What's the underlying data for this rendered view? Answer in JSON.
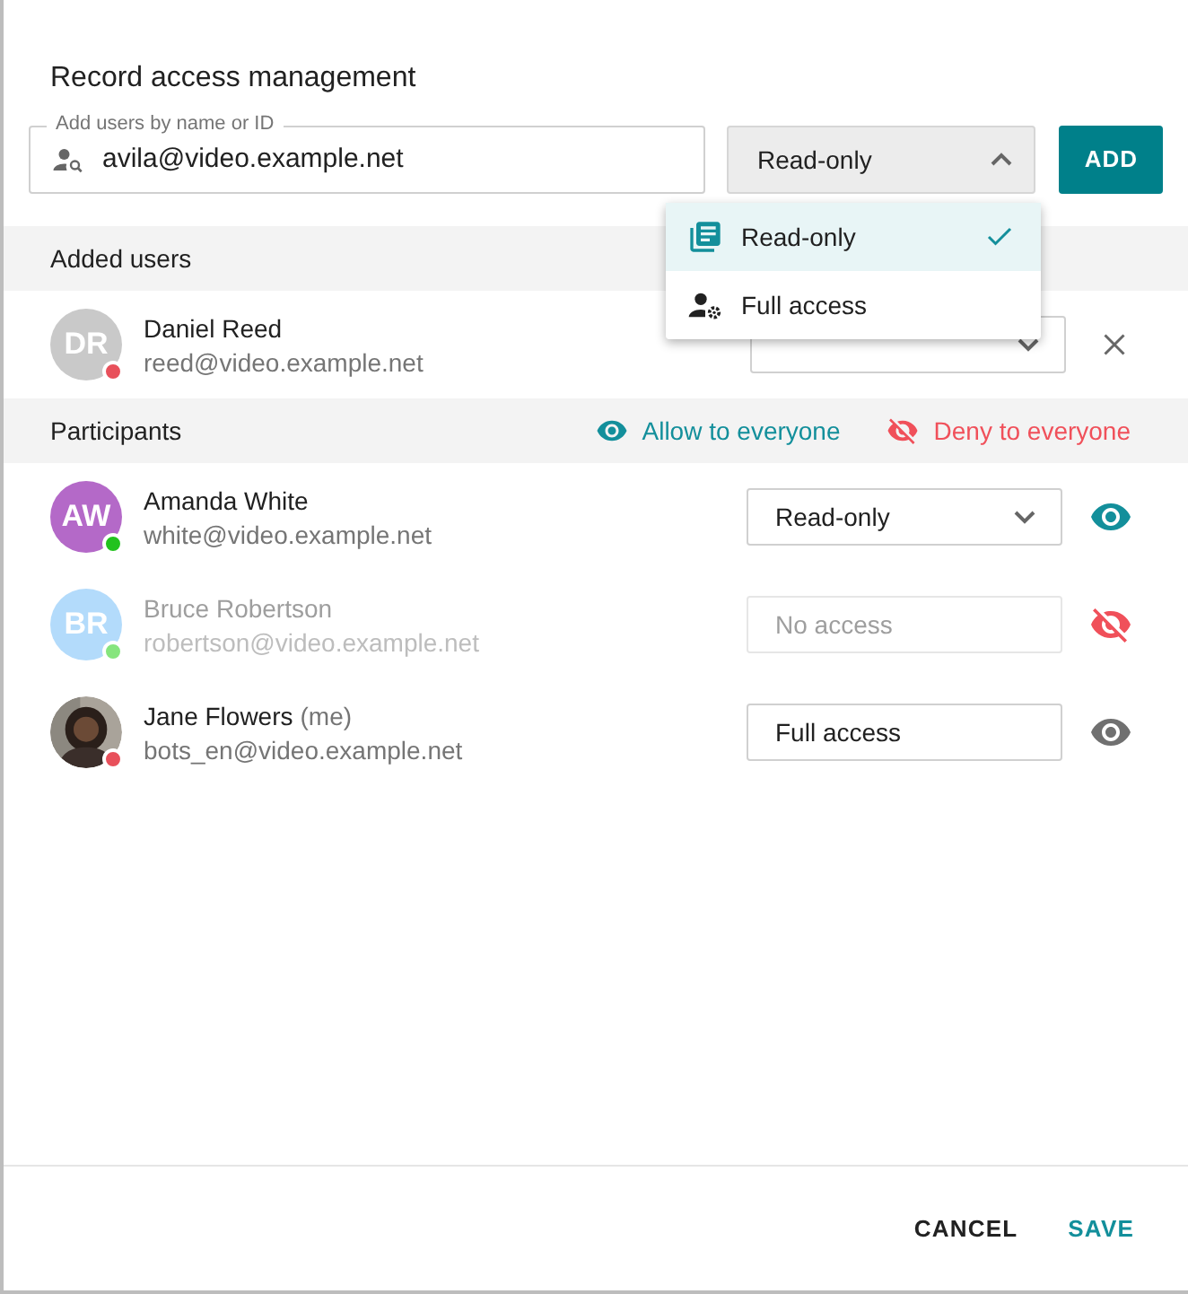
{
  "dialog": {
    "title": "Record access management"
  },
  "add_user": {
    "label": "Add users by name or ID",
    "value": "avila@video.example.net",
    "access": "Read-only",
    "expanded": true,
    "button": "ADD"
  },
  "access_menu": [
    {
      "label": "Read-only",
      "kind": "read",
      "selected": true
    },
    {
      "label": "Full access",
      "kind": "full",
      "selected": false
    }
  ],
  "added_users": {
    "title": "Added users",
    "rows": [
      {
        "avatar": {
          "initials": "DR",
          "color": "#c9c9c9"
        },
        "status": {
          "color": "#e8505b"
        },
        "name": "Daniel Reed",
        "email": "reed@video.example.net"
      }
    ]
  },
  "participants": {
    "title": "Participants",
    "allow_all": "Allow to everyone",
    "deny_all": "Deny to everyone",
    "rows": [
      {
        "avatar": {
          "kind": "initials",
          "initials": "AW",
          "color": "#b469c8"
        },
        "status": {
          "color": "#22c21e"
        },
        "name": "Amanda White",
        "email": "white@video.example.net",
        "access": "Read-only",
        "dropdown": true,
        "disabled": false,
        "toggle": {
          "kind": "allow"
        }
      },
      {
        "avatar": {
          "kind": "initials",
          "initials": "BR",
          "color": "#b3dbfb"
        },
        "status": {
          "color": "#86e57d"
        },
        "name": "Bruce Robertson",
        "email": "robertson@video.example.net",
        "access": "No access",
        "dropdown": false,
        "disabled": true,
        "toggle": {
          "kind": "deny"
        }
      },
      {
        "status": {
          "color": "#e8505b"
        },
        "name": "Jane Flowers",
        "suffix": "(me)",
        "email": "bots_en@video.example.net",
        "access": "Full access",
        "dropdown": false,
        "disabled": false,
        "toggle": {
          "kind": "own"
        }
      }
    ]
  },
  "footer": {
    "cancel": "CANCEL",
    "save": "SAVE"
  }
}
